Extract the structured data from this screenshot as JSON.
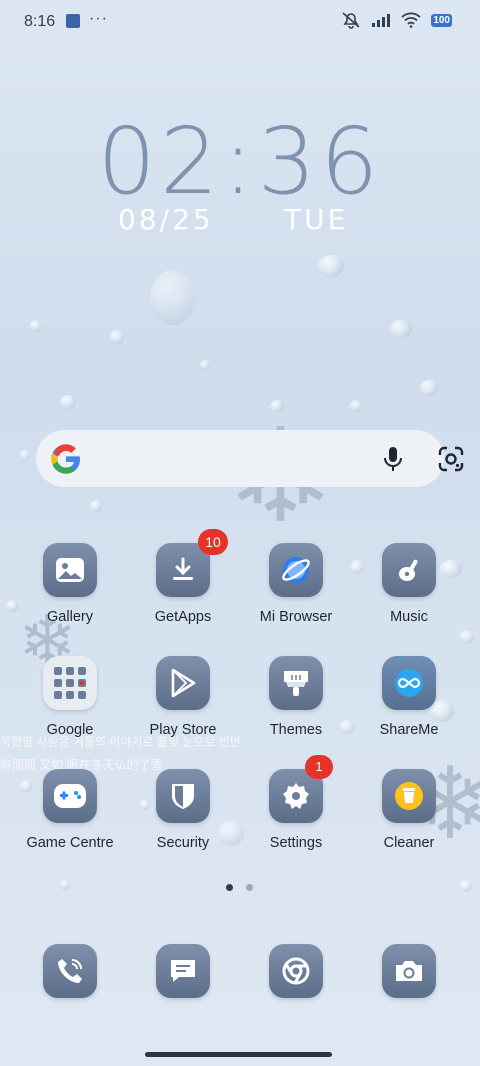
{
  "status_bar": {
    "time": "8:16",
    "more": "···",
    "battery": "100",
    "icons": [
      "notification-square-icon",
      "mute-icon",
      "signal-icon",
      "wifi-icon",
      "battery-icon"
    ]
  },
  "lock_clock": {
    "time": "02:36",
    "date": "08/25",
    "day": "TUE"
  },
  "search_bar": {
    "icons": [
      "google-logo-icon",
      "microphone-icon",
      "google-lens-icon"
    ]
  },
  "wallpaper_text": {
    "line1": "쪽했할 사랑은 거름의 이야기로 흘빛 눈으로 빈번",
    "line2": "時間而 又如 眼在冬天仏的了雪"
  },
  "apps": [
    {
      "label": "Gallery",
      "icon": "gallery-icon"
    },
    {
      "label": "GetApps",
      "icon": "download-icon",
      "badge": "10"
    },
    {
      "label": "Mi Browser",
      "icon": "browser-icon"
    },
    {
      "label": "Music",
      "icon": "music-icon"
    },
    {
      "label": "Google",
      "icon": "google-folder-icon"
    },
    {
      "label": "Play Store",
      "icon": "play-store-icon"
    },
    {
      "label": "Themes",
      "icon": "themes-icon"
    },
    {
      "label": "ShareMe",
      "icon": "shareme-icon"
    },
    {
      "label": "Game Centre",
      "icon": "gamepad-icon"
    },
    {
      "label": "Security",
      "icon": "shield-icon"
    },
    {
      "label": "Settings",
      "icon": "gear-icon",
      "badge": "1"
    },
    {
      "label": "Cleaner",
      "icon": "trash-icon"
    }
  ],
  "pager": {
    "pages": 2,
    "current": 1
  },
  "dock": [
    {
      "name": "phone",
      "icon": "phone-icon"
    },
    {
      "name": "messages",
      "icon": "messages-icon"
    },
    {
      "name": "chrome",
      "icon": "chrome-icon"
    },
    {
      "name": "camera",
      "icon": "camera-icon"
    }
  ],
  "colors": {
    "badge": "#e5332a",
    "icon_bg": "#6b7d98",
    "accent": "#3a6fd0"
  }
}
